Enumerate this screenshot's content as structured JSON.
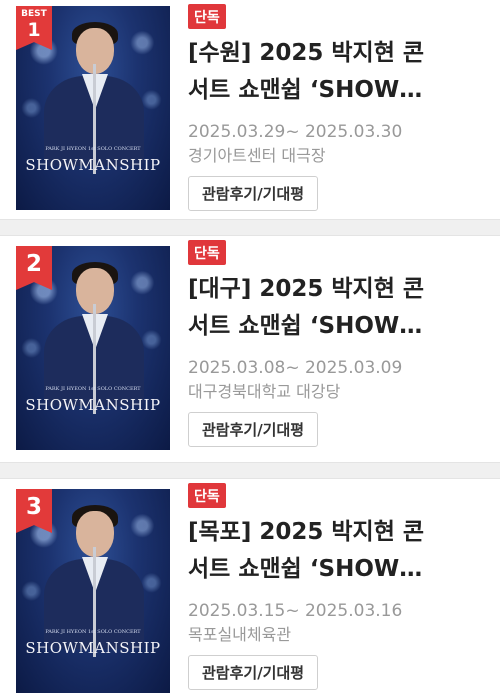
{
  "items": [
    {
      "rank_best": "BEST",
      "rank": "1",
      "badge": "단독",
      "title_line1": "[수원] 2025 박지현 콘",
      "title_line2": "서트 쇼맨쉽 ‘SHOW…",
      "dates": "2025.03.29~ 2025.03.30",
      "venue": "경기아트센터 대극장",
      "button": "관람후기/기대평",
      "poster_title": "SHOWMANSHIP",
      "poster_sub": "PARK JI HYEON 1st SOLO CONCERT"
    },
    {
      "rank": "2",
      "badge": "단독",
      "title_line1": "[대구] 2025 박지현 콘",
      "title_line2": "서트 쇼맨쉽 ‘SHOW…",
      "dates": "2025.03.08~ 2025.03.09",
      "venue": "대구경북대학교 대강당",
      "button": "관람후기/기대평",
      "poster_title": "SHOWMANSHIP",
      "poster_sub": "PARK JI HYEON 1st SOLO CONCERT"
    },
    {
      "rank": "3",
      "badge": "단독",
      "title_line1": "[목포] 2025 박지현 콘",
      "title_line2": "서트 쇼맨쉽 ‘SHOW…",
      "dates": "2025.03.15~ 2025.03.16",
      "venue": "목포실내체육관",
      "button": "관람후기/기대평",
      "poster_title": "SHOWMANSHIP",
      "poster_sub": "PARK JI HYEON 1st SOLO CONCERT"
    }
  ],
  "colors": {
    "badge": "#e0373b",
    "rank_ribbon": "#e23a3a",
    "meta_text": "#999999",
    "divider": "#f0f0f0"
  }
}
